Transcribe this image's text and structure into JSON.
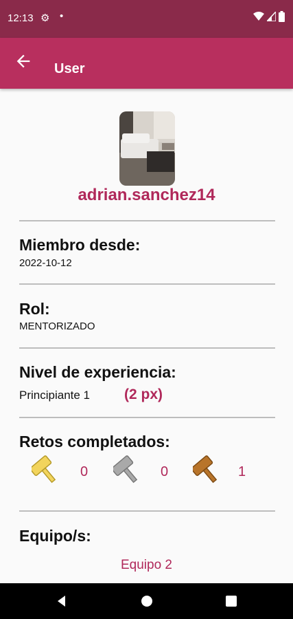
{
  "status_bar": {
    "time": "12:13"
  },
  "app_bar": {
    "title": "User"
  },
  "profile": {
    "username": "adrian.sanchez14"
  },
  "member_since": {
    "label": "Miembro desde:",
    "value": "2022-10-12"
  },
  "role": {
    "label": "Rol:",
    "value": "MENTORIZADO"
  },
  "experience": {
    "label": "Nivel de experiencia:",
    "level": "Principiante 1",
    "points": "(2 px)"
  },
  "challenges": {
    "label": "Retos completados:",
    "items": [
      {
        "icon": "gold-gavel-icon",
        "color": "#f2d45c",
        "count": "0"
      },
      {
        "icon": "silver-gavel-icon",
        "color": "#a9a9a9",
        "count": "0"
      },
      {
        "icon": "bronze-gavel-icon",
        "color": "#b8742a",
        "count": "1"
      }
    ]
  },
  "teams": {
    "label": "Equipo/s:",
    "items": [
      "Equipo 2"
    ]
  },
  "colors": {
    "status_bar": "#8a2a4a",
    "app_bar": "#b82f5e",
    "accent": "#b0285a"
  }
}
